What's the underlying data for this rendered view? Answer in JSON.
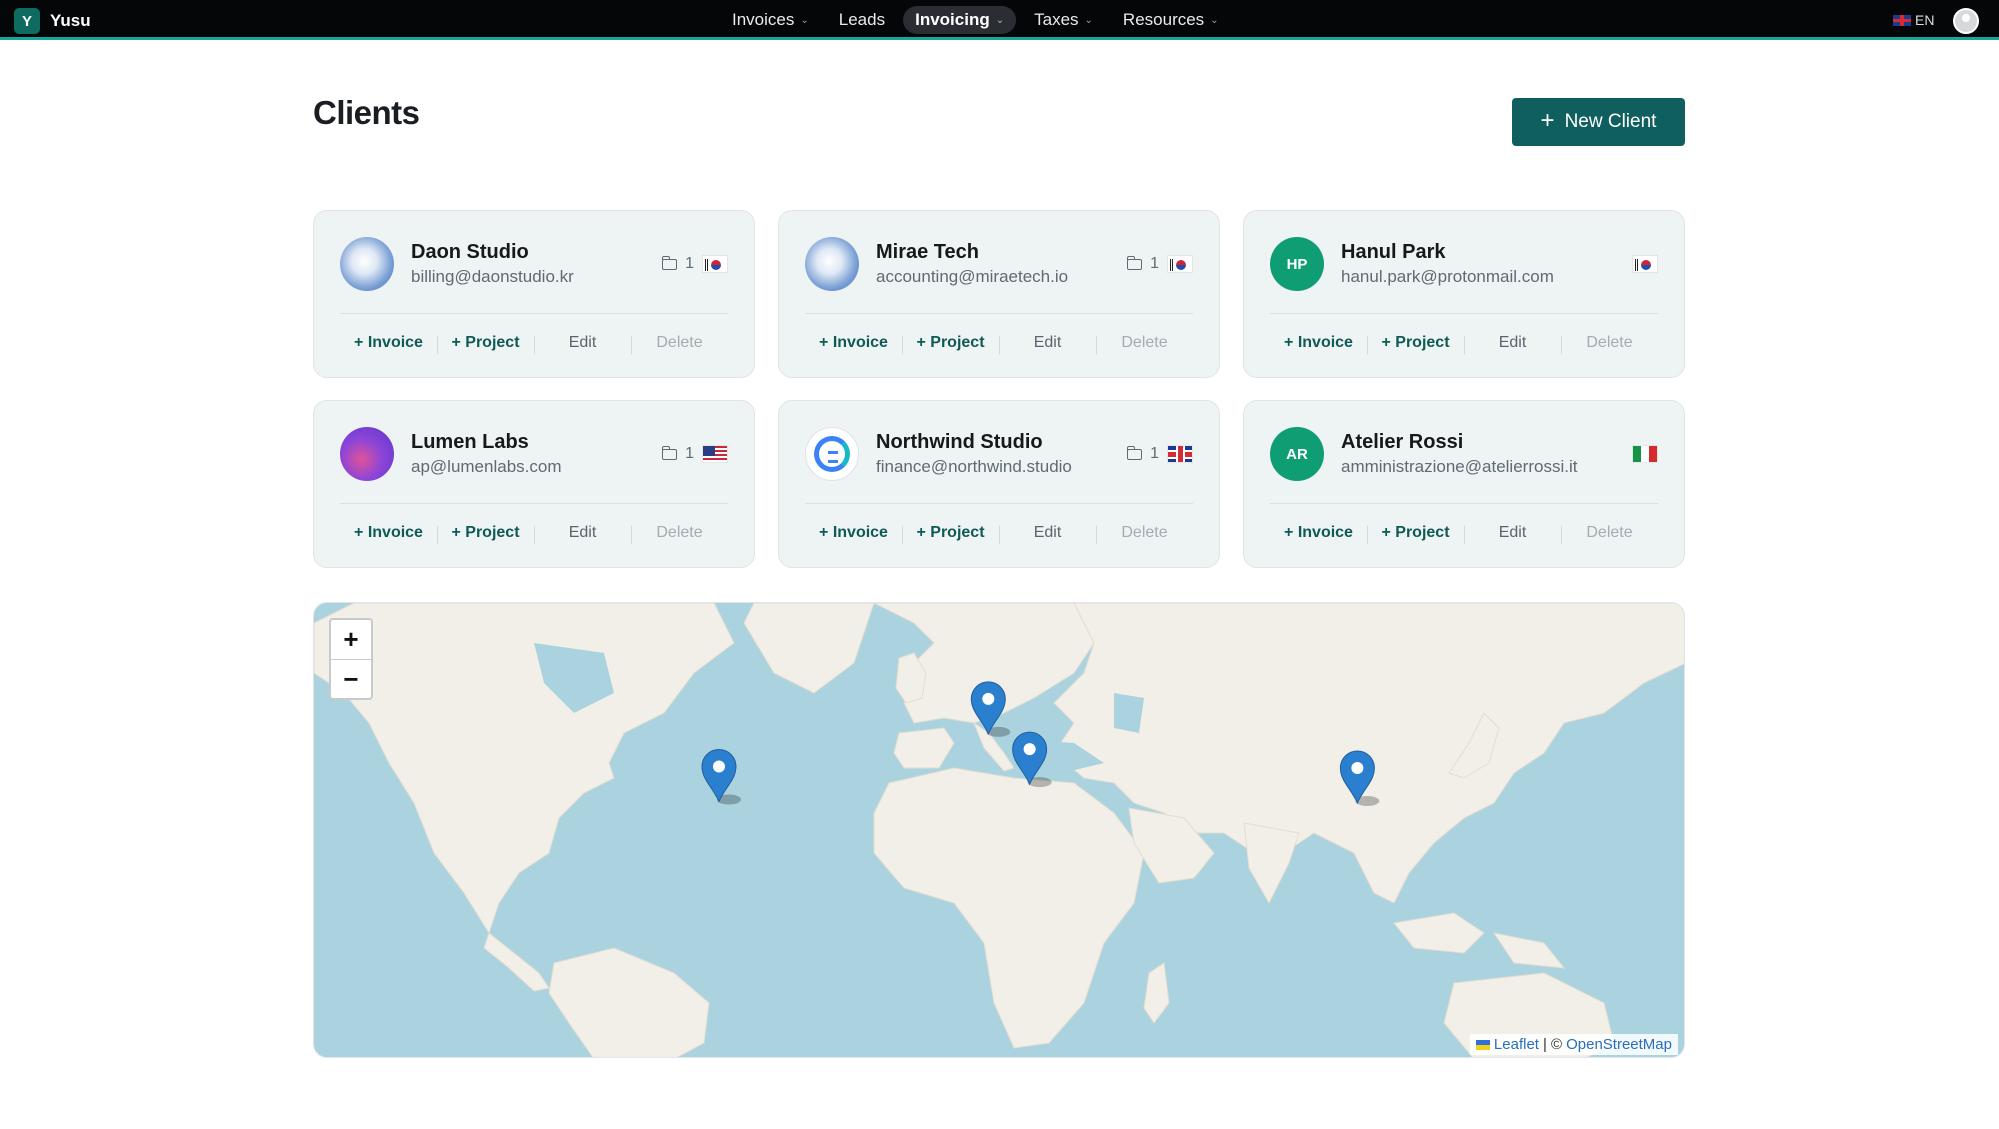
{
  "brand": {
    "letter": "Y",
    "name": "Yusu"
  },
  "nav": [
    {
      "label": "Invoices",
      "dropdown": true,
      "active": false
    },
    {
      "label": "Leads",
      "dropdown": false,
      "active": false
    },
    {
      "label": "Invoicing",
      "dropdown": true,
      "active": true
    },
    {
      "label": "Taxes",
      "dropdown": true,
      "active": false
    },
    {
      "label": "Resources",
      "dropdown": true,
      "active": false
    }
  ],
  "lang": "EN",
  "header": {
    "title": "Clients",
    "new_button": "New Client"
  },
  "actions": {
    "invoice": "+ Invoice",
    "project": "+ Project",
    "edit": "Edit",
    "delete": "Delete"
  },
  "clients": [
    {
      "name": "Daon Studio",
      "email": "billing@daonstudio.kr",
      "projects": "1",
      "flag": "kr",
      "logo": "globe"
    },
    {
      "name": "Mirae Tech",
      "email": "accounting@miraetech.io",
      "projects": "1",
      "flag": "kr",
      "logo": "globe"
    },
    {
      "name": "Hanul Park",
      "email": "hanul.park@protonmail.com",
      "projects": "",
      "flag": "kr",
      "logo": "HP"
    },
    {
      "name": "Lumen Labs",
      "email": "ap@lumenlabs.com",
      "projects": "1",
      "flag": "us",
      "logo": "lumen"
    },
    {
      "name": "Northwind Studio",
      "email": "finance@northwind.studio",
      "projects": "1",
      "flag": "uk",
      "logo": "northwind"
    },
    {
      "name": "Atelier Rossi",
      "email": "amministrazione@atelierrossi.it",
      "projects": "",
      "flag": "it",
      "logo": "AR"
    }
  ],
  "map": {
    "zoom_in": "+",
    "zoom_out": "−",
    "attribution": {
      "leaflet": "Leaflet",
      "sep": "| ©",
      "osm": "OpenStreetMap"
    },
    "markers": [
      {
        "place": "United States",
        "lat": 37.5,
        "lon": -96.5
      },
      {
        "place": "United Kingdom",
        "lat": 54.0,
        "lon": -2.0
      },
      {
        "place": "Italy",
        "lat": 43.5,
        "lon": 12.5
      },
      {
        "place": "South Korea",
        "lat": 37.0,
        "lon": 127.5
      }
    ]
  },
  "colors": {
    "accent": "#0f5f5e",
    "marker": "#2b7fcf",
    "ocean": "#aad3df",
    "land": "#f2efe9"
  }
}
